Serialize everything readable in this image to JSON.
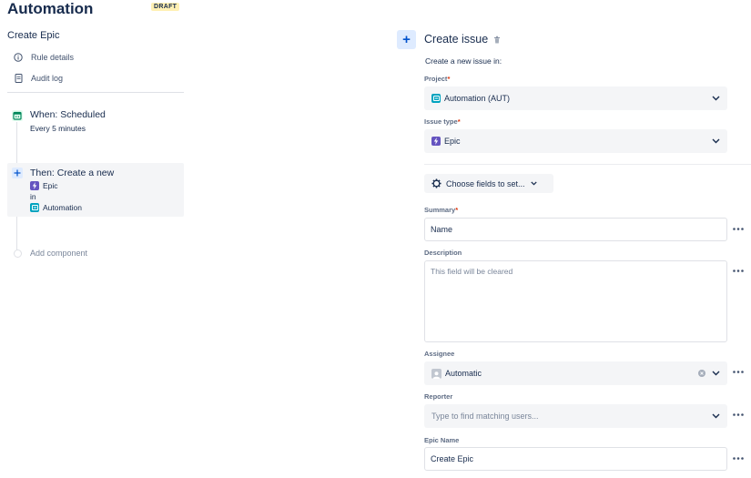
{
  "app": {
    "title": "Automation",
    "status_badge": "DRAFT"
  },
  "rule": {
    "name": "Create Epic",
    "nav": [
      {
        "label": "Rule details",
        "icon": "info-icon"
      },
      {
        "label": "Audit log",
        "icon": "document-icon"
      }
    ],
    "trigger": {
      "title": "When: Scheduled",
      "subtitle": "Every 5 minutes",
      "icon": "calendar-icon"
    },
    "action": {
      "title": "Then: Create a new",
      "issue_type": "Epic",
      "connector": "in",
      "project": "Automation",
      "icon": "plus-icon"
    },
    "add_component_label": "Add component"
  },
  "editor": {
    "title": "Create issue",
    "subtitle": "Create a new issue in:",
    "project": {
      "label": "Project",
      "value": "Automation (AUT)"
    },
    "issue_type": {
      "label": "Issue type",
      "value": "Epic"
    },
    "choose_fields_label": "Choose fields to set...",
    "summary": {
      "label": "Summary",
      "value": "Name"
    },
    "description": {
      "label": "Description",
      "placeholder": "This field will be cleared"
    },
    "assignee": {
      "label": "Assignee",
      "value": "Automatic"
    },
    "reporter": {
      "label": "Reporter",
      "placeholder": "Type to find matching users..."
    },
    "epic_name": {
      "label": "Epic Name",
      "value": "Create Epic"
    },
    "required_marker": "*"
  },
  "colors": {
    "accent": "#0052cc",
    "epic": "#6554c0",
    "project": "#00a3bf",
    "trigger": "#00875a",
    "draft_bg": "#fff0b3"
  }
}
